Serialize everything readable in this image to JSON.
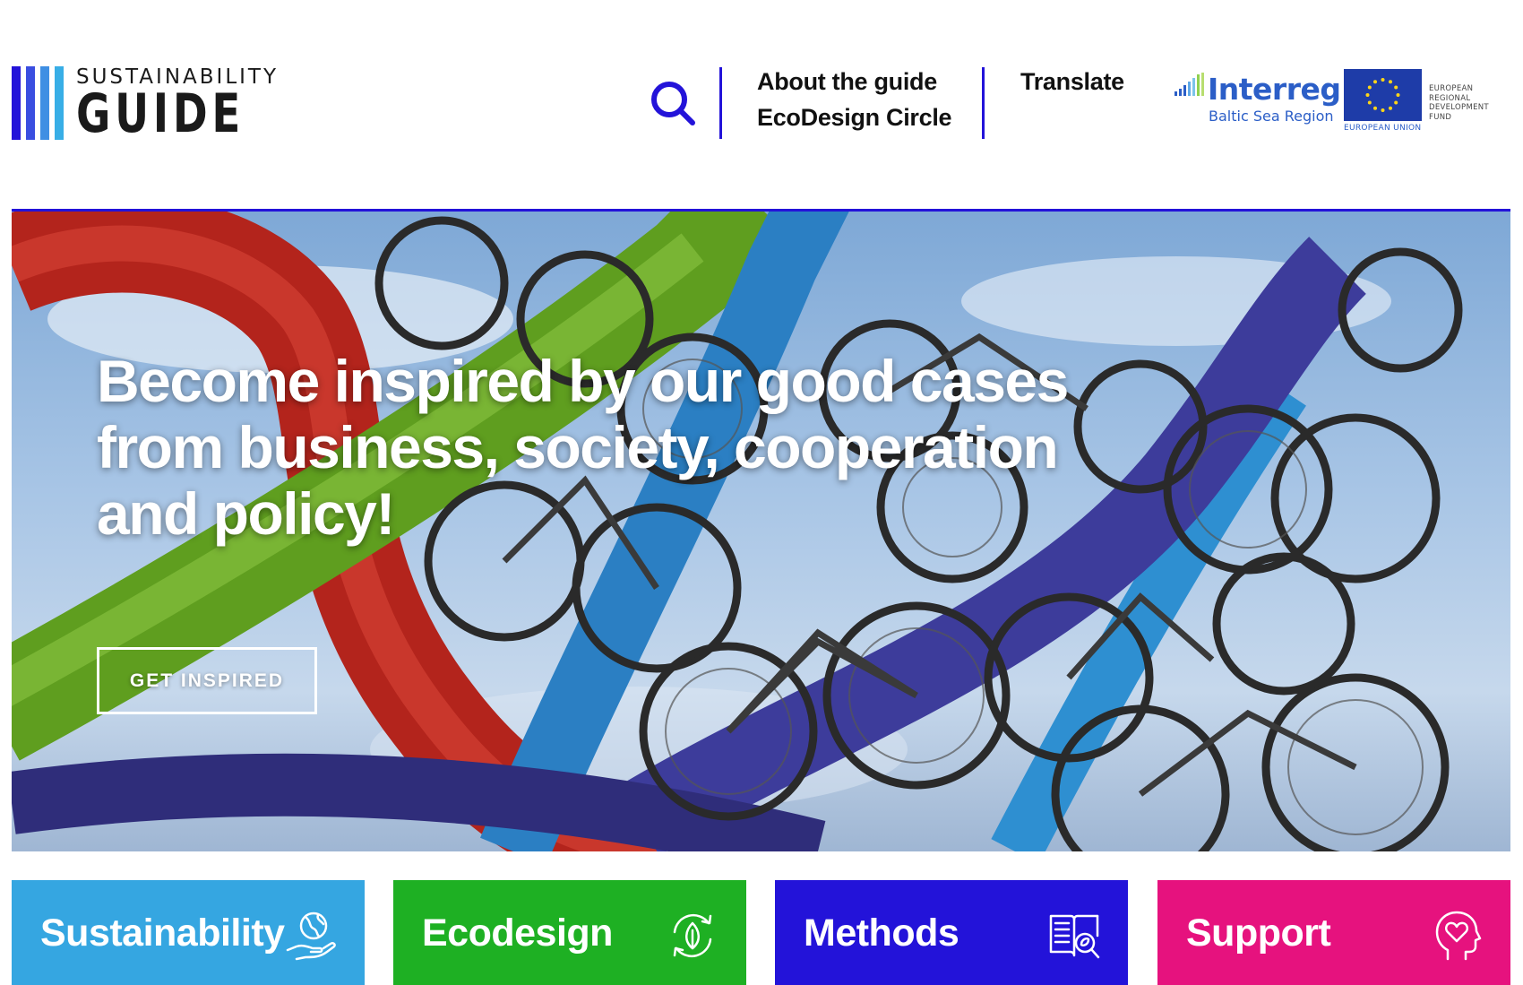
{
  "header": {
    "logo": {
      "top_text": "SUSTAINABILITY",
      "big_text": "GUIDE",
      "bar_colors": [
        "#2313d9",
        "#3a4ee0",
        "#3f8fe3",
        "#38aee6"
      ]
    },
    "search_icon": "search-icon",
    "nav": [
      {
        "label": "About the guide"
      },
      {
        "label": "EcoDesign Circle"
      }
    ],
    "translate_label": "Translate",
    "partners": {
      "interreg_word": "Interreg",
      "interreg_sub": "Baltic Sea Region",
      "eu_label": "EUROPEAN UNION",
      "erdf_lines": [
        "EUROPEAN",
        "REGIONAL",
        "DEVELOPMENT",
        "FUND"
      ]
    }
  },
  "hero": {
    "title": "Become inspired by our good cases from business, society, cooperation and policy!",
    "cta_label": "GET INSPIRED"
  },
  "tiles": [
    {
      "label": "Sustainability",
      "color": "#35a6e1",
      "icon": "globe-in-hand-icon"
    },
    {
      "label": "Ecodesign",
      "color": "#1eb023",
      "icon": "leaf-cycle-icon"
    },
    {
      "label": "Methods",
      "color": "#2313d9",
      "icon": "book-magnifier-icon"
    },
    {
      "label": "Support",
      "color": "#e6127e",
      "icon": "head-heart-icon"
    }
  ],
  "colors": {
    "accent": "#2313d9"
  }
}
